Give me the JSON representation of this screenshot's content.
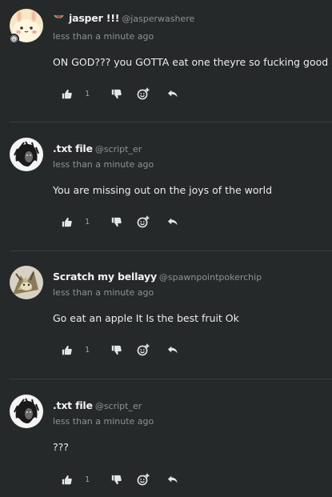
{
  "colors": {
    "background": "#25292a",
    "divider": "#3a3e40",
    "text": "#ececec",
    "muted": "#8e9294"
  },
  "comments": [
    {
      "avatar": "cream-bunny-avatar",
      "has_status_badge": true,
      "flair_icon": "watermelon-icon",
      "display_name": "jasper !!!",
      "handle": "@jasperwashere",
      "timestamp": "less than a minute ago",
      "text": "ON GOD??? you GOTTA eat one theyre so fucking good",
      "like_count": "1"
    },
    {
      "avatar": "dark-scribble-avatar",
      "has_status_badge": false,
      "flair_icon": "",
      "display_name": ".txt file",
      "handle": "@script_er",
      "timestamp": "less than a minute ago",
      "text": "You are missing out on the joys of the world",
      "like_count": "1"
    },
    {
      "avatar": "creature-avatar",
      "has_status_badge": false,
      "flair_icon": "",
      "display_name": "Scratch my bellayy",
      "handle": "@spawnpointpokerchip",
      "timestamp": "less than a minute ago",
      "text": "Go eat an apple It Is the best fruit Ok",
      "like_count": "1"
    },
    {
      "avatar": "dark-scribble-avatar",
      "has_status_badge": false,
      "flair_icon": "",
      "display_name": ".txt file",
      "handle": "@script_er",
      "timestamp": "less than a minute ago",
      "text": "???",
      "like_count": "1"
    }
  ]
}
